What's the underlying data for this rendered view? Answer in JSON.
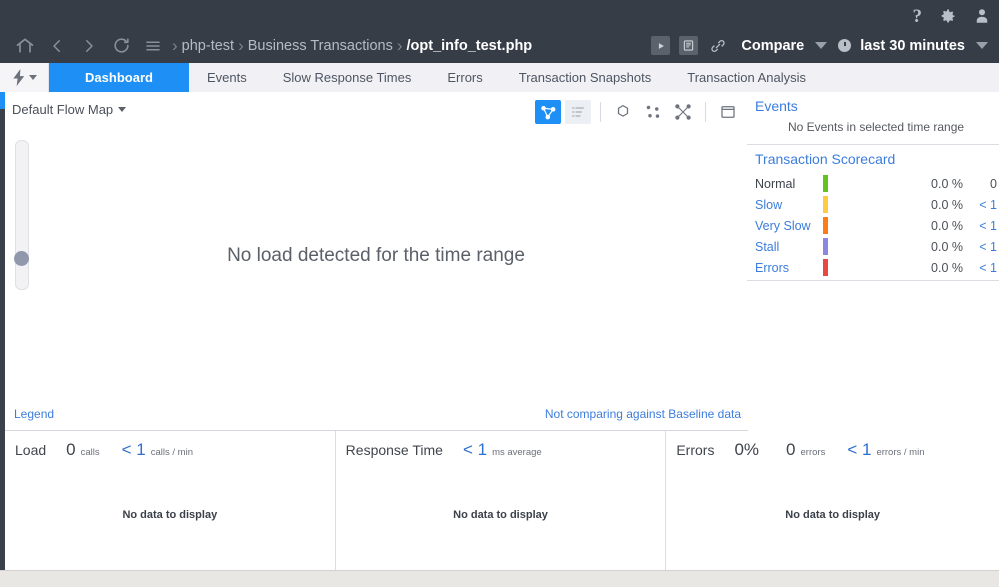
{
  "topbar": {
    "icons": [
      {
        "name": "help-icon",
        "glyph": "?"
      },
      {
        "name": "settings-gear-icon",
        "glyph": "gear"
      },
      {
        "name": "user-account-icon",
        "glyph": "person"
      }
    ],
    "nav_icons": [
      {
        "name": "home-icon"
      },
      {
        "name": "back-arrow-icon"
      },
      {
        "name": "forward-arrow-icon"
      },
      {
        "name": "refresh-icon"
      },
      {
        "name": "menu-icon"
      }
    ],
    "breadcrumb": [
      {
        "label": "php-test",
        "current": false
      },
      {
        "label": "Business Transactions",
        "current": false
      },
      {
        "label": "/opt_info_test.php",
        "current": true
      }
    ],
    "separator": "›",
    "compare_label": "Compare",
    "time_range_label": "last 30 minutes",
    "right_icons": [
      {
        "name": "play-button-icon"
      },
      {
        "name": "report-list-icon"
      },
      {
        "name": "link-chain-icon"
      }
    ]
  },
  "tabs": {
    "bolt_menu_name": "actions-bolt-menu",
    "items": [
      {
        "label": "Dashboard",
        "active": true
      },
      {
        "label": "Events",
        "active": false
      },
      {
        "label": "Slow Response Times",
        "active": false
      },
      {
        "label": "Errors",
        "active": false
      },
      {
        "label": "Transaction Snapshots",
        "active": false
      },
      {
        "label": "Transaction Analysis",
        "active": false
      }
    ]
  },
  "flowmap": {
    "selector_label": "Default Flow Map",
    "empty_message": "No load detected for the time range",
    "legend_link": "Legend",
    "baseline_link": "Not comparing against Baseline data",
    "tools": [
      {
        "name": "flow-map-view-icon",
        "state": "active"
      },
      {
        "name": "list-view-icon",
        "state": "shaded"
      },
      {
        "name": "circle-layout-icon",
        "state": "plain"
      },
      {
        "name": "scatter-layout-icon",
        "state": "plain"
      },
      {
        "name": "collapse-layout-icon",
        "state": "plain"
      },
      {
        "name": "fullscreen-icon",
        "state": "plain"
      }
    ],
    "zoom_slider_name": "flow-map-zoom-slider"
  },
  "sidebar": {
    "events": {
      "title": "Events",
      "empty_message": "No Events in selected time range"
    },
    "scorecard": {
      "title": "Transaction Scorecard",
      "rows": [
        {
          "label": "Normal",
          "color": "#62c41f",
          "percent": "0.0 %",
          "count": "0",
          "count_is_link": false,
          "label_is_link": false
        },
        {
          "label": "Slow",
          "color": "#ffcb3f",
          "percent": "0.0 %",
          "count": "< 1",
          "count_is_link": true,
          "label_is_link": true
        },
        {
          "label": "Very Slow",
          "color": "#ff7b18",
          "percent": "0.0 %",
          "count": "< 1",
          "count_is_link": true,
          "label_is_link": true
        },
        {
          "label": "Stall",
          "color": "#8b86e0",
          "percent": "0.0 %",
          "count": "< 1",
          "count_is_link": true,
          "label_is_link": true
        },
        {
          "label": "Errors",
          "color": "#e8483f",
          "percent": "0.0 %",
          "count": "< 1",
          "count_is_link": true,
          "label_is_link": true
        }
      ]
    }
  },
  "metrics": {
    "no_data_message": "No data to display",
    "panels": [
      {
        "title": "Load",
        "stats": [
          {
            "value": "0",
            "unit": "calls",
            "blue": false
          },
          {
            "value": "< 1",
            "unit": "calls / min",
            "blue": true
          }
        ]
      },
      {
        "title": "Response Time",
        "stats": [
          {
            "value": "< 1",
            "unit": "ms average",
            "blue": true
          }
        ]
      },
      {
        "title": "Errors",
        "stats": [
          {
            "value": "0%",
            "unit": "",
            "blue": false
          },
          {
            "value": "0",
            "unit": "errors",
            "blue": false
          },
          {
            "value": "< 1",
            "unit": "errors / min",
            "blue": true
          }
        ]
      }
    ]
  }
}
